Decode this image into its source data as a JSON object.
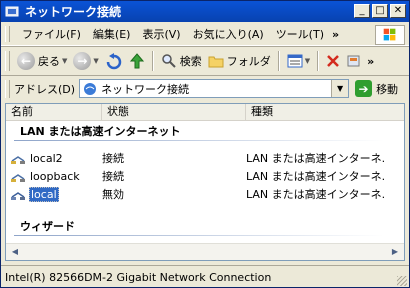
{
  "window": {
    "title": "ネットワーク接続"
  },
  "menu": {
    "items": [
      "ファイル(F)",
      "編集(E)",
      "表示(V)",
      "お気に入り(A)",
      "ツール(T)"
    ],
    "overflow": "»"
  },
  "toolbar": {
    "back": "戻る",
    "search": "検索",
    "folders": "フォルダ",
    "overflow": "»"
  },
  "address": {
    "label": "アドレス(D)",
    "value": "ネットワーク接続",
    "go": "移動"
  },
  "columns": [
    "名前",
    "状態",
    "種類"
  ],
  "groups": [
    {
      "label": "LAN または高速インターネット"
    },
    {
      "label": "ウィザード"
    }
  ],
  "rows": [
    {
      "name": "local2",
      "status": "接続",
      "type": "LAN または高速インターネ..."
    },
    {
      "name": "loopback",
      "status": "接続",
      "type": "LAN または高速インターネ..."
    },
    {
      "name": "local",
      "status": "無効",
      "type": "LAN または高速インターネ..."
    }
  ],
  "status": {
    "text": "Intel(R) 82566DM-2 Gigabit Network Connection"
  }
}
